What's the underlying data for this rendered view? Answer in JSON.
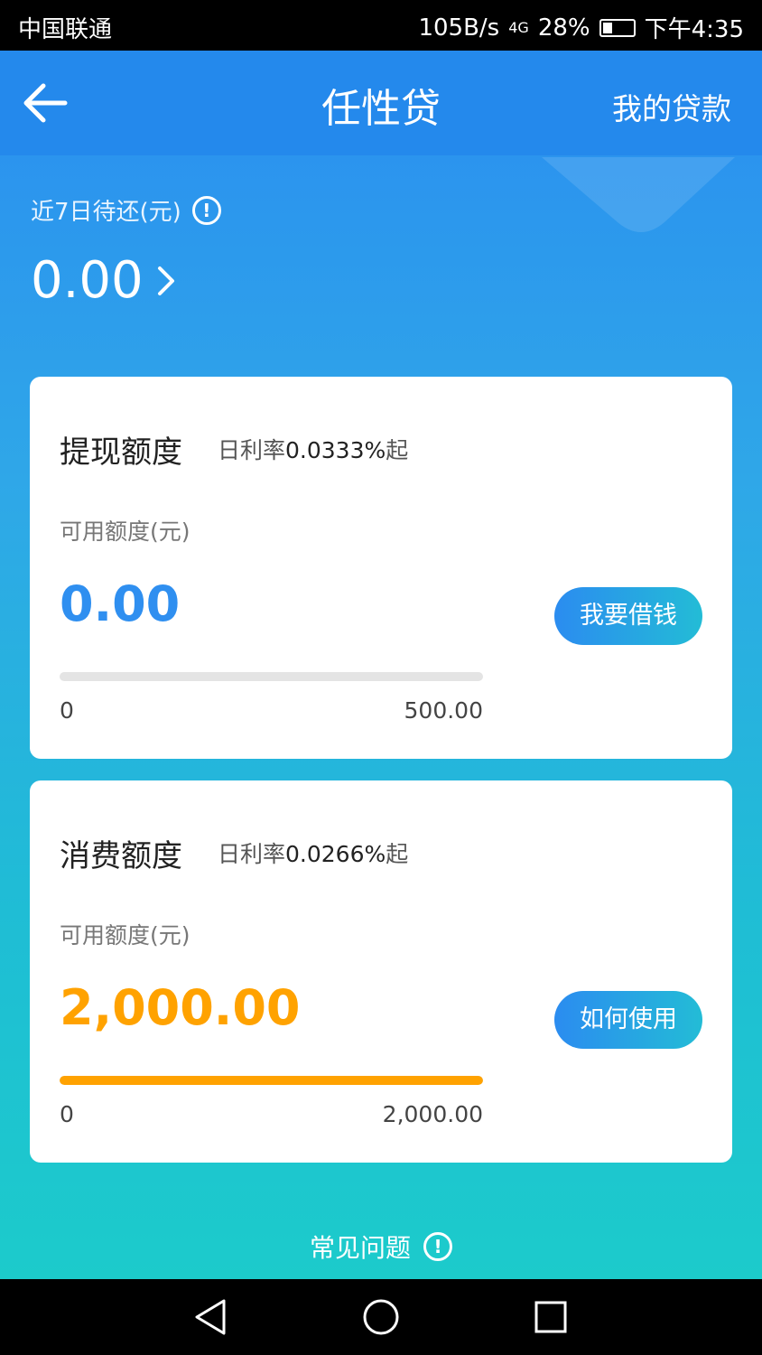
{
  "status_bar": {
    "carrier": "中国联通",
    "net_speed": "105B/s",
    "network": "4G",
    "battery": "28%",
    "time": "下午4:35"
  },
  "header": {
    "title": "任性贷",
    "my_loans": "我的贷款"
  },
  "due": {
    "label": "近7日待还(元)",
    "amount": "0.00"
  },
  "cards": [
    {
      "title": "提现额度",
      "rate_prefix": "日利率",
      "rate_value": "0.0333%",
      "rate_suffix": "起",
      "avail_label": "可用额度(元)",
      "amount": "0.00",
      "button": "我要借钱",
      "min": "0",
      "max": "500.00",
      "fill_fraction": 0
    },
    {
      "title": "消费额度",
      "rate_prefix": "日利率",
      "rate_value": "0.0266%",
      "rate_suffix": "起",
      "avail_label": "可用额度(元)",
      "amount": "2,000.00",
      "button": "如何使用",
      "min": "0",
      "max": "2,000.00",
      "fill_fraction": 1
    }
  ],
  "faq": {
    "label": "常见问题"
  },
  "icons": [
    "back-arrow-icon",
    "info-icon",
    "chevron-right-icon",
    "nav-back-icon",
    "nav-home-icon",
    "nav-recents-icon"
  ],
  "colors": {
    "header": "#2489ec",
    "amount_blue": "#2f8ff0",
    "amount_orange": "#ffa200",
    "gradient_top": "#2a8ef0",
    "gradient_bottom": "#1ccbcb"
  }
}
